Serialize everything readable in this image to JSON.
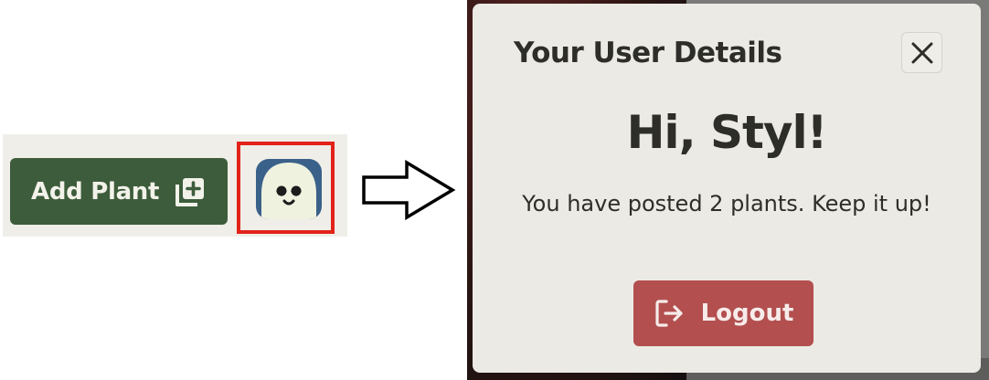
{
  "toolbar": {
    "add_plant_label": "Add Plant",
    "add_plant_icon": "add-square-icon",
    "avatar_icon": "ghost-avatar-icon"
  },
  "arrow_icon": "right-arrow-icon",
  "modal": {
    "title": "Your User Details",
    "close_icon": "close-icon",
    "greeting": "Hi, Styl!",
    "message": "You have posted 2 plants. Keep it up!",
    "logout_label": "Logout",
    "logout_icon": "logout-icon"
  },
  "colors": {
    "primary_green": "#3d5c3b",
    "logout_red": "#b34f4f",
    "highlight_red": "#e2231a",
    "modal_bg": "#eceae5",
    "toolbar_bg": "#efeee8",
    "avatar_blue": "#3a6189"
  }
}
